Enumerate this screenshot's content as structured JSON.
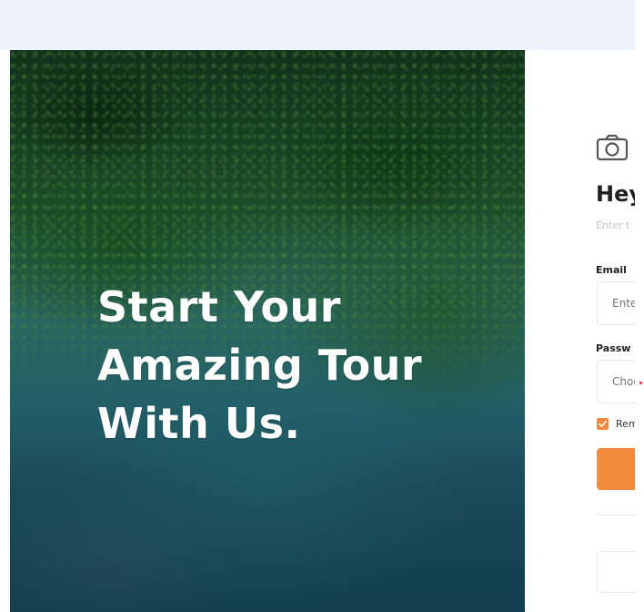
{
  "hero": {
    "title_lines": [
      "Start Your",
      "Amazing Tour",
      "With Us."
    ]
  },
  "form": {
    "logo_icon": "camera-icon",
    "heading": "Hey",
    "subtitle": "Enter t",
    "email_label": "Email",
    "email_placeholder": "Ente",
    "password_label": "Passw",
    "password_placeholder": "Choo",
    "remember_label": "Rem",
    "remember_checked": true,
    "accent_color": "#f28d3e"
  }
}
